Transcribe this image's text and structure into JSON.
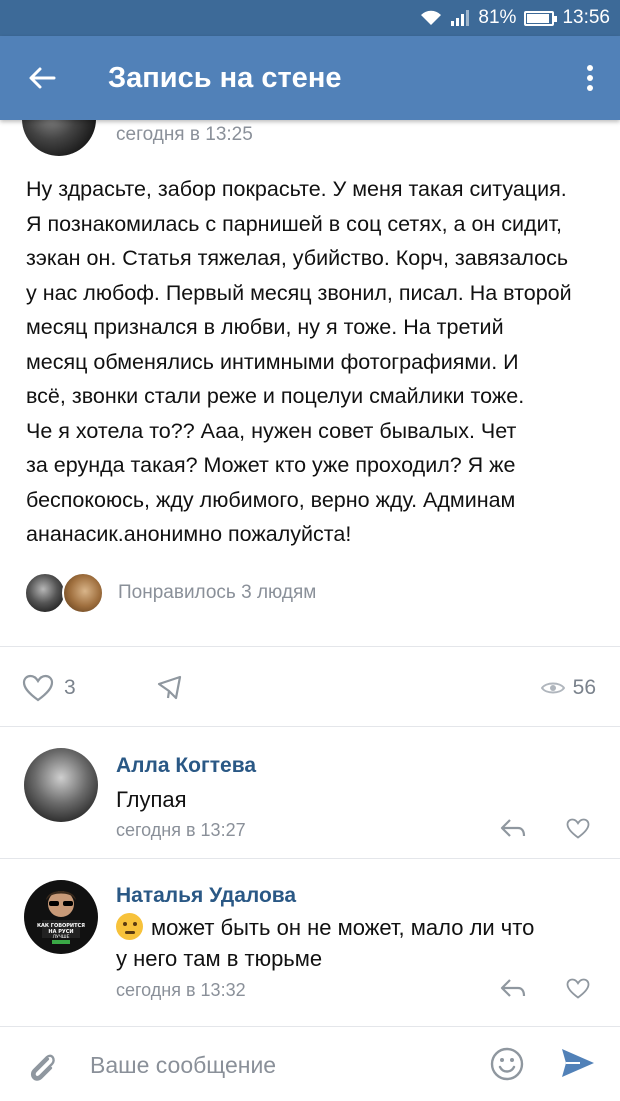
{
  "status_bar": {
    "battery": "81%",
    "time": "13:56"
  },
  "app_bar": {
    "title": "Запись на стене"
  },
  "post": {
    "time": "сегодня в 13:25",
    "lines": [
      "Ну здрасьте, забор покрасьте. У меня такая ситуация.",
      "Я познакомилась с парнишей в соц сетях, а он сидит,",
      "зэкан он. Статья тяжелая, убийство. Корч, завязалось",
      "у нас любоф. Первый месяц звонил, писал. На второй",
      "месяц признался в любви, ну я тоже. На третий",
      "месяц обменялись интимными фотографиями. И",
      "всё, звонки стали реже и поцелуи смайлики тоже.",
      "Че я хотела то?? Ааа, нужен совет бывалых. Чет",
      "за ерунда такая? Может кто уже проходил? Я же",
      "беспокоюсь, жду любимого, верно жду. Админам",
      "ананасик.анонимно пожалуйста!"
    ],
    "likes_text": "Понравилось 3 людям",
    "like_count": "3",
    "views": "56"
  },
  "comments": [
    {
      "author": "Алла Когтева",
      "text": "Глупая",
      "time": "сегодня в 13:27"
    },
    {
      "author": "Наталья Удалова",
      "text_line1": "может быть он не может, мало ли что",
      "text_line2": "у него там в тюрьме",
      "time": "сегодня в 13:32",
      "avatar_caption": "КАК ГОВОРИТСЯ НА РУСИ ЛУЧШЕ"
    }
  ],
  "composer": {
    "placeholder": "Ваше сообщение"
  },
  "colors": {
    "header": "#5181b8",
    "status": "#3d6a98",
    "link": "#2a5885",
    "meta": "#8a9099",
    "send": "#5181b8"
  },
  "icons": [
    "wifi-icon",
    "signal-icon",
    "battery-icon",
    "back-arrow-icon",
    "more-vertical-icon",
    "heart-icon",
    "share-icon",
    "eye-icon",
    "reply-icon",
    "attach-icon",
    "smile-icon",
    "send-icon"
  ]
}
